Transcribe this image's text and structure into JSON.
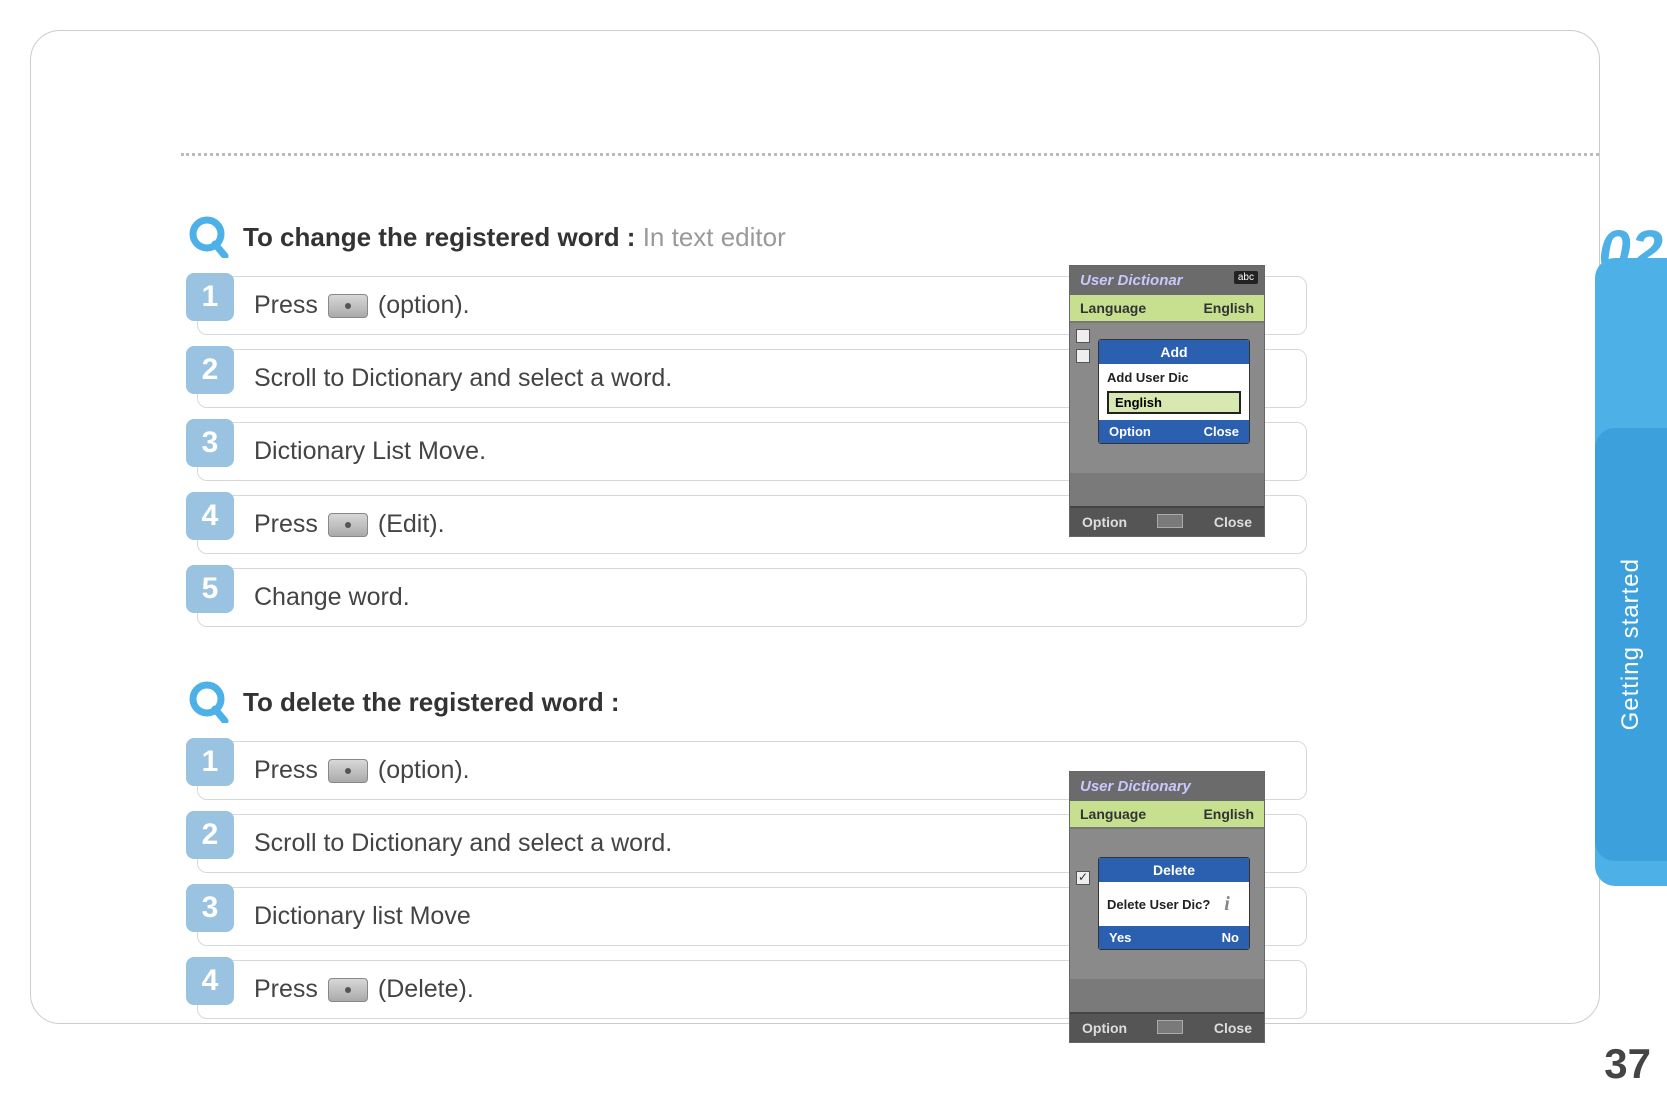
{
  "chapter_num": "02",
  "side_label": "Getting started",
  "page_number": "37",
  "section1": {
    "title_bold": "To change the registered word : ",
    "title_light": "In text editor",
    "steps": [
      {
        "num": "1",
        "pre": "Press",
        "icon": true,
        "post": "(option)."
      },
      {
        "num": "2",
        "text": "Scroll to Dictionary and select a word."
      },
      {
        "num": "3",
        "text": "Dictionary List Move."
      },
      {
        "num": "4",
        "pre": "Press",
        "icon": true,
        "post": "(Edit)."
      },
      {
        "num": "5",
        "text": "Change word."
      }
    ]
  },
  "section2": {
    "title_bold": "To delete the registered word :",
    "steps": [
      {
        "num": "1",
        "pre": "Press",
        "icon": true,
        "post": "(option)."
      },
      {
        "num": "2",
        "text": "Scroll to Dictionary and select a word."
      },
      {
        "num": "3",
        "text": "Dictionary list Move"
      },
      {
        "num": "4",
        "pre": "Press",
        "icon": true,
        "post": "(Delete)."
      }
    ]
  },
  "device1": {
    "title": "User Dictionar",
    "abc": "abc",
    "lang_label": "Language",
    "lang_value": "English",
    "popup_header": "Add",
    "popup_body": "Add User Dic",
    "popup_english": "English",
    "popup_left": "Option",
    "popup_right": "Close",
    "footer_left": "Option",
    "footer_right": "Close"
  },
  "device2": {
    "title": "User Dictionary",
    "lang_label": "Language",
    "lang_value": "English",
    "popup_header": "Delete",
    "popup_body": "Delete User Dic?",
    "popup_left": "Yes",
    "popup_right": "No",
    "footer_left": "Option",
    "footer_right": "Close"
  }
}
